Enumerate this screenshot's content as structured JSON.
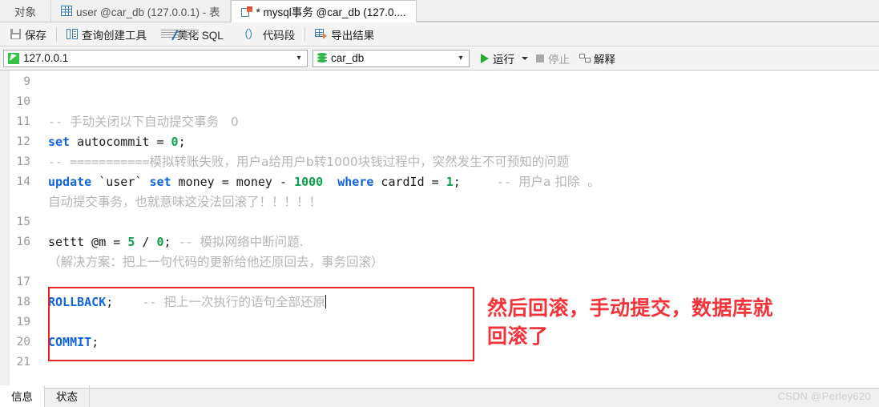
{
  "tabs": {
    "object_tab": "对象",
    "items": [
      {
        "label": "user @car_db (127.0.0.1) - 表",
        "icon": "table-grid-icon",
        "active": false
      },
      {
        "label": "* mysql事务 @car_db (127.0....",
        "icon": "sql-file-icon",
        "active": true
      }
    ]
  },
  "toolbar": {
    "save": "保存",
    "query_builder": "查询创建工具",
    "beautify_sql": "美化 SQL",
    "code_snippet_paren": "（）",
    "code_snippet": "代码段",
    "export_result": "导出结果"
  },
  "connbar": {
    "host": "127.0.0.1",
    "database": "car_db",
    "run": "运行",
    "stop": "停止",
    "explain": "解释"
  },
  "editor": {
    "lines": [
      {
        "n": "9",
        "segments": []
      },
      {
        "n": "10",
        "segments": []
      },
      {
        "n": "11",
        "segments": [
          {
            "t": "-- ",
            "c": "cmt"
          },
          {
            "t": "手动关闭以下自动提交事务   0",
            "c": "cmt cjk"
          }
        ]
      },
      {
        "n": "12",
        "segments": [
          {
            "t": "set",
            "c": "kw"
          },
          {
            "t": " autocommit = ",
            "c": "plain"
          },
          {
            "t": "0",
            "c": "num"
          },
          {
            "t": ";",
            "c": "plain"
          }
        ]
      },
      {
        "n": "13",
        "segments": [
          {
            "t": "-- ===========",
            "c": "cmt"
          },
          {
            "t": "模拟转账失败，用户a给用户b转1000块钱过程中，突然发生不可预知的问题",
            "c": "cmt cjk"
          }
        ]
      },
      {
        "n": "14",
        "wrapped": true,
        "segments": [
          {
            "t": "update",
            "c": "kw"
          },
          {
            "t": " `user` ",
            "c": "plain"
          },
          {
            "t": "set",
            "c": "kw"
          },
          {
            "t": " money = money - ",
            "c": "plain"
          },
          {
            "t": "1000",
            "c": "num"
          },
          {
            "t": "  ",
            "c": "plain"
          },
          {
            "t": "where",
            "c": "kw"
          },
          {
            "t": " cardId = ",
            "c": "plain"
          },
          {
            "t": "1",
            "c": "num"
          },
          {
            "t": ";     ",
            "c": "plain"
          },
          {
            "t": "-- ",
            "c": "cmt"
          },
          {
            "t": "用户a 扣除  。",
            "c": "cmt cjk"
          }
        ],
        "wrap_text": "自动提交事务，也就意味这没法回滚了！！！！！"
      },
      {
        "n": "15",
        "segments": []
      },
      {
        "n": "16",
        "wrapped": true,
        "segments": [
          {
            "t": "settt @m = ",
            "c": "plain"
          },
          {
            "t": "5",
            "c": "num"
          },
          {
            "t": " / ",
            "c": "plain"
          },
          {
            "t": "0",
            "c": "num"
          },
          {
            "t": "; ",
            "c": "plain"
          },
          {
            "t": "-- ",
            "c": "cmt"
          },
          {
            "t": "模拟网络中断问题.",
            "c": "cmt cjk"
          }
        ],
        "wrap_text": "（解决方案：把上一句代码的更新给他还原回去，事务回滚）"
      },
      {
        "n": "17",
        "segments": []
      },
      {
        "n": "18",
        "caret": true,
        "segments": [
          {
            "t": "ROLLBACK",
            "c": "kw"
          },
          {
            "t": ";    ",
            "c": "plain"
          },
          {
            "t": "-- ",
            "c": "cmt"
          },
          {
            "t": "把上一次执行的语句全部还原",
            "c": "cmt cjk"
          }
        ]
      },
      {
        "n": "19",
        "segments": []
      },
      {
        "n": "20",
        "segments": [
          {
            "t": "COMMIT",
            "c": "kw"
          },
          {
            "t": ";",
            "c": "plain"
          }
        ]
      },
      {
        "n": "21",
        "segments": []
      }
    ],
    "annotation": "然后回滚，手动提交，数据库就\n回滚了",
    "annotation_color": "#f5333a",
    "highlight_box_color": "#ee2222"
  },
  "bottom": {
    "tabs": [
      "信息",
      "状态"
    ],
    "watermark": "CSDN @Perley620"
  }
}
